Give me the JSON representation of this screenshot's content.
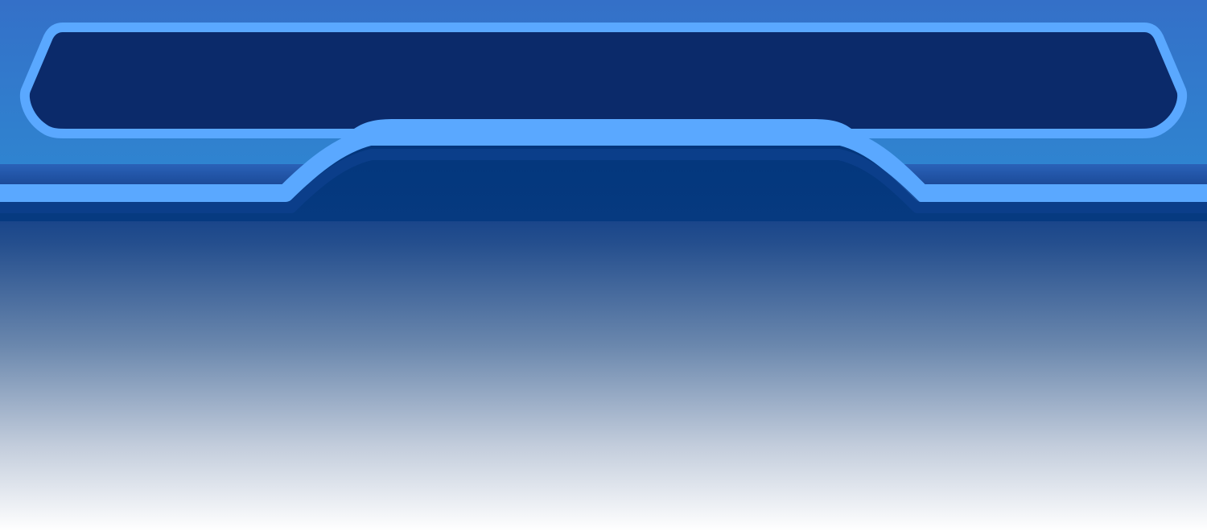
{
  "colors": {
    "header_top": "#3470c8",
    "header_bottom": "#2f84d0",
    "outline": "#5aa8ff",
    "title_panel_fill": "#0b2a6a",
    "tab_fill": "#04367a",
    "band_shadow": "#1a4c98",
    "body_top": "#0e3a84",
    "body_bottom": "#ffffff"
  }
}
